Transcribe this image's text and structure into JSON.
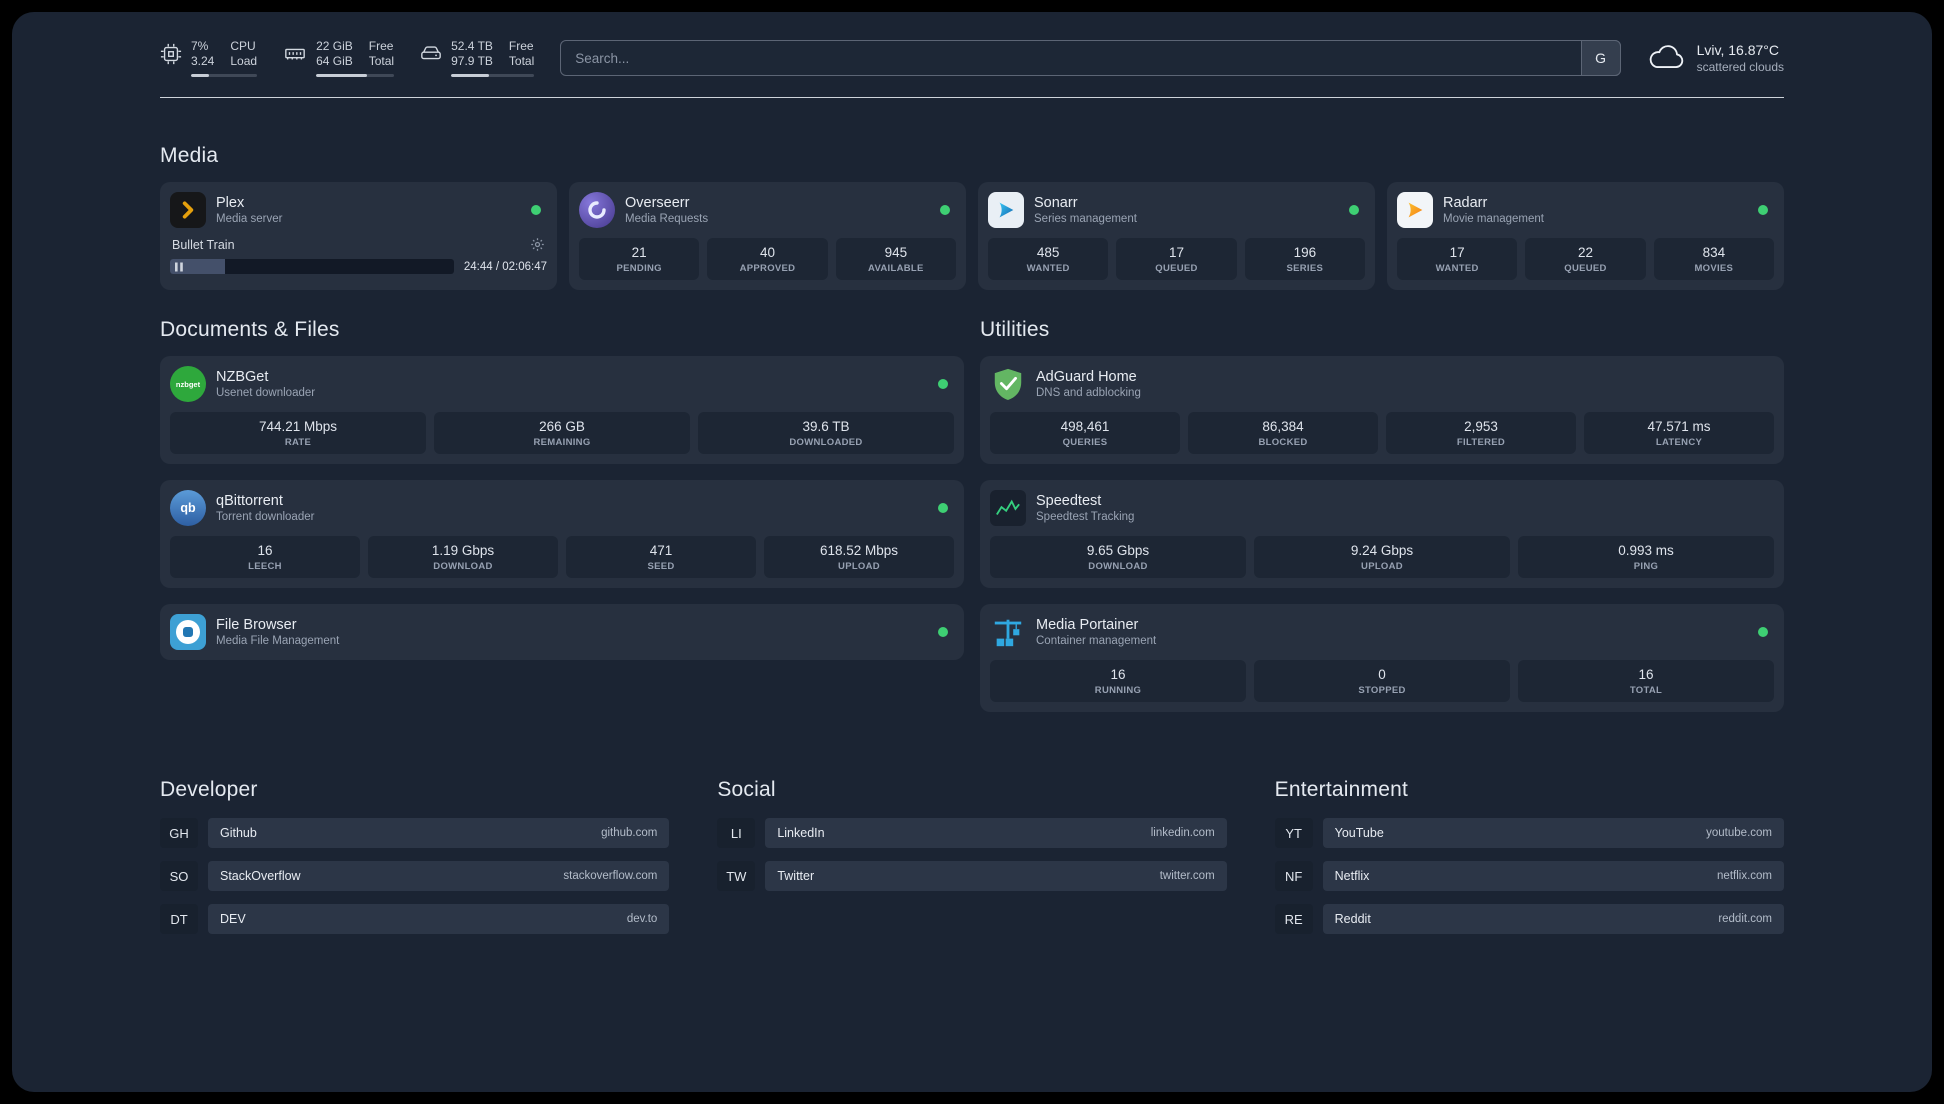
{
  "topbar": {
    "resources": [
      {
        "id": "cpu",
        "values": [
          "7%",
          "3.24"
        ],
        "labels": [
          "CPU",
          "Load"
        ],
        "bar_percent": 28
      },
      {
        "id": "memory",
        "values": [
          "22 GiB",
          "64 GiB"
        ],
        "labels": [
          "Free",
          "Total"
        ],
        "bar_percent": 65
      },
      {
        "id": "disk",
        "values": [
          "52.4 TB",
          "97.9 TB"
        ],
        "labels": [
          "Free",
          "Total"
        ],
        "bar_percent": 46
      }
    ],
    "search": {
      "placeholder": "Search...",
      "provider_label": "G"
    },
    "weather": {
      "location": "Lviv, 16.87°C",
      "condition": "scattered clouds"
    }
  },
  "sections": {
    "media": {
      "title": "Media",
      "plex": {
        "name": "Plex",
        "subtitle": "Media server",
        "now_playing": {
          "title": "Bullet Train",
          "time": "24:44 / 02:06:47",
          "progress_percent": 19.5
        }
      },
      "overseerr": {
        "name": "Overseerr",
        "subtitle": "Media Requests",
        "stats": [
          {
            "value": "21",
            "label": "PENDING"
          },
          {
            "value": "40",
            "label": "APPROVED"
          },
          {
            "value": "945",
            "label": "AVAILABLE"
          }
        ]
      },
      "sonarr": {
        "name": "Sonarr",
        "subtitle": "Series management",
        "stats": [
          {
            "value": "485",
            "label": "WANTED"
          },
          {
            "value": "17",
            "label": "QUEUED"
          },
          {
            "value": "196",
            "label": "SERIES"
          }
        ]
      },
      "radarr": {
        "name": "Radarr",
        "subtitle": "Movie management",
        "stats": [
          {
            "value": "17",
            "label": "WANTED"
          },
          {
            "value": "22",
            "label": "QUEUED"
          },
          {
            "value": "834",
            "label": "MOVIES"
          }
        ]
      }
    },
    "documents": {
      "title": "Documents & Files",
      "nzbget": {
        "name": "NZBGet",
        "subtitle": "Usenet downloader",
        "stats": [
          {
            "value": "744.21 Mbps",
            "label": "RATE"
          },
          {
            "value": "266 GB",
            "label": "REMAINING"
          },
          {
            "value": "39.6 TB",
            "label": "DOWNLOADED"
          }
        ]
      },
      "qbittorrent": {
        "name": "qBittorrent",
        "subtitle": "Torrent downloader",
        "stats": [
          {
            "value": "16",
            "label": "LEECH"
          },
          {
            "value": "1.19 Gbps",
            "label": "DOWNLOAD"
          },
          {
            "value": "471",
            "label": "SEED"
          },
          {
            "value": "618.52 Mbps",
            "label": "UPLOAD"
          }
        ]
      },
      "filebrowser": {
        "name": "File Browser",
        "subtitle": "Media File Management"
      }
    },
    "utilities": {
      "title": "Utilities",
      "adguard": {
        "name": "AdGuard Home",
        "subtitle": "DNS and adblocking",
        "stats": [
          {
            "value": "498,461",
            "label": "QUERIES"
          },
          {
            "value": "86,384",
            "label": "BLOCKED"
          },
          {
            "value": "2,953",
            "label": "FILTERED"
          },
          {
            "value": "47.571 ms",
            "label": "LATENCY"
          }
        ]
      },
      "speedtest": {
        "name": "Speedtest",
        "subtitle": "Speedtest Tracking",
        "stats": [
          {
            "value": "9.65 Gbps",
            "label": "DOWNLOAD"
          },
          {
            "value": "9.24 Gbps",
            "label": "UPLOAD"
          },
          {
            "value": "0.993 ms",
            "label": "PING"
          }
        ]
      },
      "portainer": {
        "name": "Media Portainer",
        "subtitle": "Container management",
        "stats": [
          {
            "value": "16",
            "label": "RUNNING"
          },
          {
            "value": "0",
            "label": "STOPPED"
          },
          {
            "value": "16",
            "label": "TOTAL"
          }
        ]
      }
    }
  },
  "bookmarks": {
    "developer": {
      "title": "Developer",
      "items": [
        {
          "abbr": "GH",
          "name": "Github",
          "domain": "github.com"
        },
        {
          "abbr": "SO",
          "name": "StackOverflow",
          "domain": "stackoverflow.com"
        },
        {
          "abbr": "DT",
          "name": "DEV",
          "domain": "dev.to"
        }
      ]
    },
    "social": {
      "title": "Social",
      "items": [
        {
          "abbr": "LI",
          "name": "LinkedIn",
          "domain": "linkedin.com"
        },
        {
          "abbr": "TW",
          "name": "Twitter",
          "domain": "twitter.com"
        }
      ]
    },
    "entertainment": {
      "title": "Entertainment",
      "items": [
        {
          "abbr": "YT",
          "name": "YouTube",
          "domain": "youtube.com"
        },
        {
          "abbr": "NF",
          "name": "Netflix",
          "domain": "netflix.com"
        },
        {
          "abbr": "RE",
          "name": "Reddit",
          "domain": "reddit.com"
        }
      ]
    }
  },
  "icon_labels": {
    "nzbget": "nzbget",
    "qbittorrent": "qb"
  },
  "colors": {
    "status_online": "#3ecf73",
    "plex_amber": "#e5a00d",
    "adguard_green": "#63b663",
    "portainer_blue": "#2fa8e1",
    "speedtest_green": "#35d07f"
  }
}
